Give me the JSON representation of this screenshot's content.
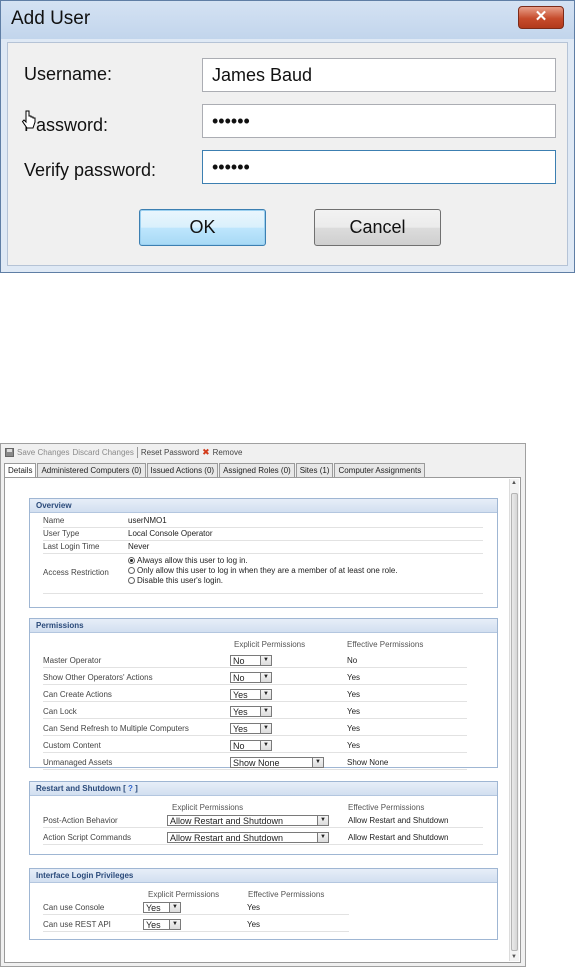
{
  "dialog": {
    "title": "Add User",
    "close_glyph": "✕",
    "username_label": "Username:",
    "username_value": "James Baud",
    "password_label": "Password:",
    "password_value": "••••••",
    "verify_label": "Verify password:",
    "verify_value": "••••••",
    "ok_label": "OK",
    "cancel_label": "Cancel"
  },
  "toolbar": {
    "save": "Save Changes",
    "discard": "Discard Changes",
    "reset": "Reset Password",
    "remove": "Remove",
    "remove_icon": "✖"
  },
  "tabs": [
    "Details",
    "Administered Computers (0)",
    "Issued Actions (0)",
    "Assigned Roles (0)",
    "Sites (1)",
    "Computer Assignments"
  ],
  "overview": {
    "title": "Overview",
    "name_label": "Name",
    "name_value": "userNMO1",
    "type_label": "User Type",
    "type_value": "Local Console Operator",
    "login_label": "Last Login Time",
    "login_value": "Never",
    "access_label": "Access Restriction",
    "access_options": [
      "Always allow this user to log in.",
      "Only allow this user to log in when they are a member of at least one role.",
      "Disable this user's login."
    ]
  },
  "permissions": {
    "title": "Permissions",
    "col_explicit": "Explicit Permissions",
    "col_effective": "Effective Permissions",
    "rows": [
      {
        "label": "Master Operator",
        "explicit": "No",
        "effective": "No"
      },
      {
        "label": "Show Other Operators' Actions",
        "explicit": "No",
        "effective": "Yes"
      },
      {
        "label": "Can Create Actions",
        "explicit": "Yes",
        "effective": "Yes"
      },
      {
        "label": "Can Lock",
        "explicit": "Yes",
        "effective": "Yes"
      },
      {
        "label": "Can Send Refresh to Multiple Computers",
        "explicit": "Yes",
        "effective": "Yes"
      },
      {
        "label": "Custom Content",
        "explicit": "No",
        "effective": "Yes"
      },
      {
        "label": "Unmanaged Assets",
        "explicit": "Show None",
        "effective": "Show None"
      }
    ]
  },
  "restart": {
    "title": "Restart and Shutdown",
    "help": "?",
    "col_explicit": "Explicit Permissions",
    "col_effective": "Effective Permissions",
    "rows": [
      {
        "label": "Post-Action Behavior",
        "explicit": "Allow Restart and Shutdown",
        "effective": "Allow Restart and Shutdown"
      },
      {
        "label": "Action Script Commands",
        "explicit": "Allow Restart and Shutdown",
        "effective": "Allow Restart and Shutdown"
      }
    ]
  },
  "login": {
    "title": "Interface Login Privileges",
    "col_explicit": "Explicit Permissions",
    "col_effective": "Effective Permissions",
    "rows": [
      {
        "label": "Can use Console",
        "explicit": "Yes",
        "effective": "Yes"
      },
      {
        "label": "Can use REST API",
        "explicit": "Yes",
        "effective": "Yes"
      }
    ]
  }
}
